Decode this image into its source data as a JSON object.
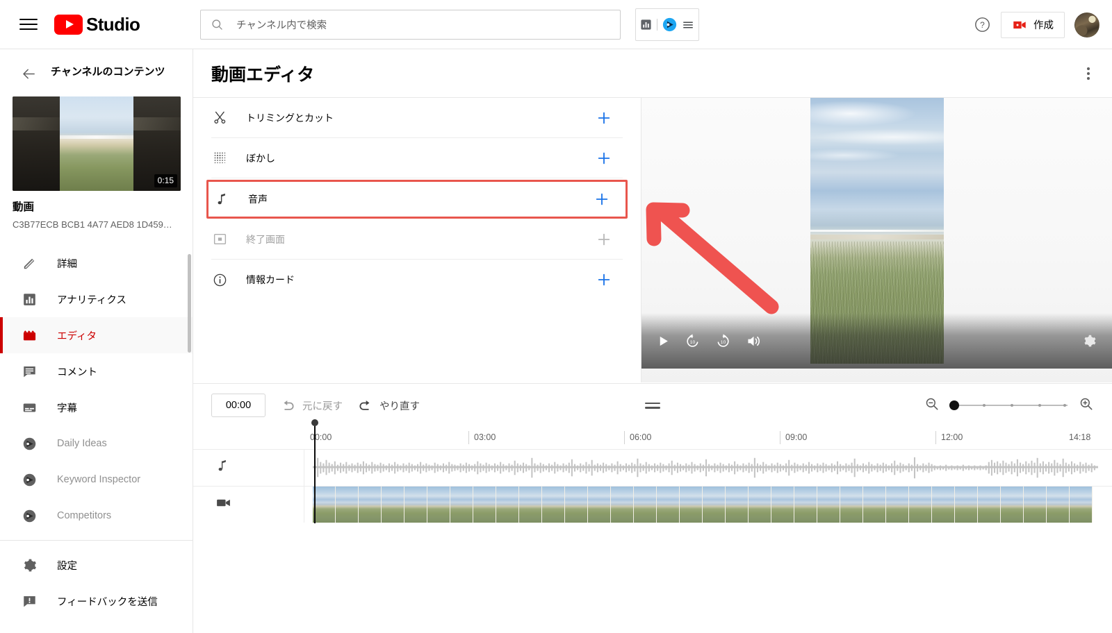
{
  "topbar": {
    "menu_icon": "hamburger-icon",
    "brand": "Studio",
    "search_placeholder": "チャンネル内で検索",
    "search_value": "",
    "search_icon": "search-icon",
    "ext_analytics_icon": "analytics-extension-icon",
    "ext_vidiq_icon": "vidiq-extension-icon",
    "ext_menu_icon": "extension-menu-icon",
    "help_icon": "help-circle-icon",
    "create_label": "作成",
    "create_icon": "video-plus-icon",
    "avatar_icon": "user-avatar"
  },
  "sidebar": {
    "back_icon": "back-arrow-icon",
    "title": "チャンネルのコンテンツ",
    "thumbnail": {
      "duration": "0:15"
    },
    "video_label": "動画",
    "video_id": "C3B77ECB BCB1 4A77 AED8 1D459…",
    "items": [
      {
        "label": "詳細",
        "icon": "pencil-icon",
        "state": "normal"
      },
      {
        "label": "アナリティクス",
        "icon": "bar-chart-icon",
        "state": "normal"
      },
      {
        "label": "エディタ",
        "icon": "clapperboard-icon",
        "state": "active"
      },
      {
        "label": "コメント",
        "icon": "comment-icon",
        "state": "normal"
      },
      {
        "label": "字幕",
        "icon": "subtitles-icon",
        "state": "normal"
      },
      {
        "label": "Daily Ideas",
        "icon": "vidiq-icon",
        "state": "muted"
      },
      {
        "label": "Keyword Inspector",
        "icon": "vidiq-icon",
        "state": "muted"
      },
      {
        "label": "Competitors",
        "icon": "vidiq-icon",
        "state": "muted"
      }
    ],
    "footer_items": [
      {
        "label": "設定",
        "icon": "gear-icon"
      },
      {
        "label": "フィードバックを送信",
        "icon": "feedback-icon"
      }
    ]
  },
  "main": {
    "page_title": "動画エディタ",
    "kebab_icon": "more-options-icon",
    "tools": [
      {
        "label": "トリミングとカット",
        "icon": "scissors-icon",
        "add_icon": "plus-icon",
        "state": "normal"
      },
      {
        "label": "ぼかし",
        "icon": "blur-dots-icon",
        "add_icon": "plus-icon",
        "state": "normal"
      },
      {
        "label": "音声",
        "icon": "music-note-icon",
        "add_icon": "plus-icon",
        "state": "highlighted"
      },
      {
        "label": "終了画面",
        "icon": "end-screen-icon",
        "add_icon": "plus-icon",
        "state": "disabled"
      },
      {
        "label": "情報カード",
        "icon": "info-circle-icon",
        "add_icon": "plus-icon",
        "state": "normal"
      }
    ],
    "player": {
      "play_icon": "play-icon",
      "rewind_icon": "replay-10-icon",
      "forward_icon": "forward-10-icon",
      "volume_icon": "volume-icon",
      "settings_icon": "settings-gear-icon"
    }
  },
  "timeline": {
    "current_time": "00:00",
    "undo_label": "元に戻す",
    "undo_icon": "undo-icon",
    "redo_label": "やり直す",
    "redo_icon": "redo-icon",
    "resize_handle_icon": "drag-handle-icon",
    "zoom_out_icon": "zoom-out-icon",
    "zoom_in_icon": "zoom-in-icon",
    "zoom_value": 0,
    "ruler_ticks": [
      "00:00",
      "03:00",
      "06:00",
      "09:00",
      "12:00",
      "14:18"
    ],
    "tracks": [
      {
        "name": "audio-track",
        "icon": "music-note-icon"
      },
      {
        "name": "video-track",
        "icon": "video-camera-icon"
      }
    ]
  },
  "annotation": {
    "arrow_color": "#ef5350",
    "highlight_color": "#e8564d"
  }
}
